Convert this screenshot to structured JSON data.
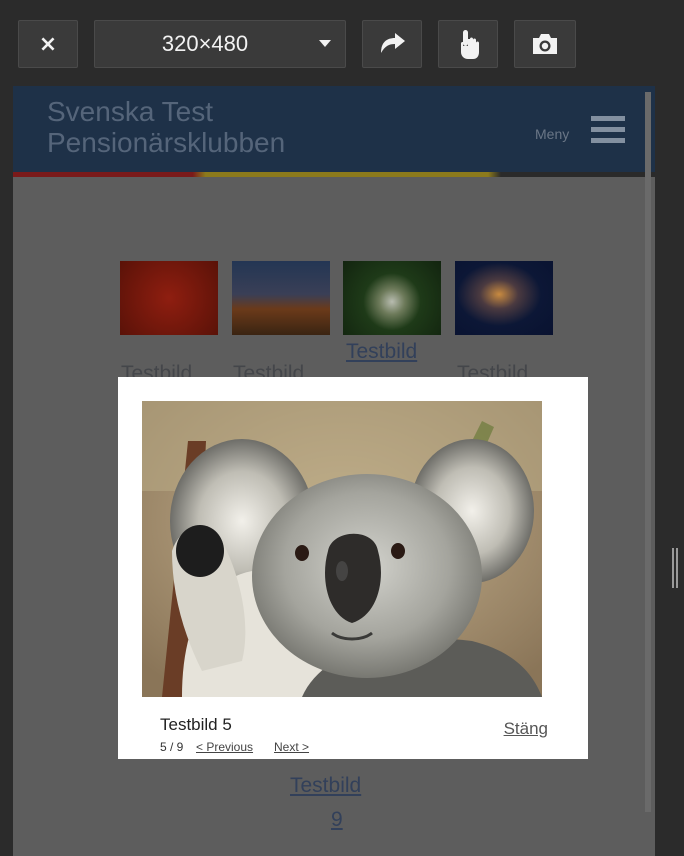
{
  "toolbar": {
    "close_symbol": "×",
    "device_size": "320×480",
    "icons": [
      "close-icon",
      "chevron-down-icon",
      "rotate-icon",
      "touch-icon",
      "camera-icon"
    ]
  },
  "site": {
    "title": "Svenska Test\nPensionärsklubben",
    "menu_label": "Meny",
    "accent_colors": [
      "#7a1a1a",
      "#8c7a1c"
    ]
  },
  "gallery": {
    "link_label": "Testbild",
    "faint_labels": [
      "Testbild",
      "Testbild",
      "Testbild"
    ],
    "bottom_label": "Testbild",
    "bottom_number": "9"
  },
  "lightbox": {
    "caption": "Testbild 5",
    "counter": "5 / 9",
    "prev": "< Previous",
    "next": "Next >",
    "close": "Stäng"
  }
}
